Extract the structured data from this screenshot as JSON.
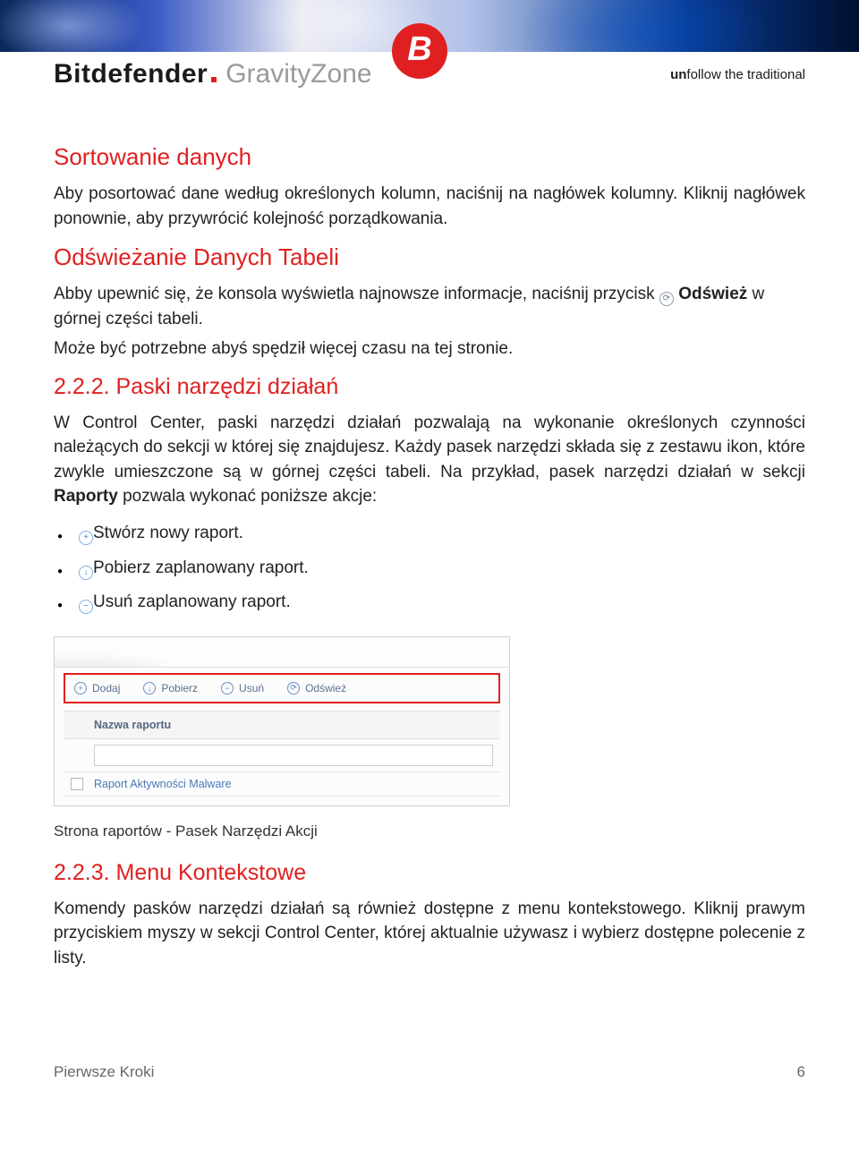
{
  "header": {
    "brand1": "Bitdefender",
    "brand2": "GravityZone",
    "badge_letter": "B",
    "tagline_prefix": "un",
    "tagline_rest": "follow the traditional"
  },
  "sort": {
    "heading": "Sortowanie danych",
    "para": "Aby posortować dane według określonych kolumn, naciśnij na nagłówek kolumny. Kliknij nagłówek ponownie, aby przywrócić kolejność porządkowania."
  },
  "refresh": {
    "heading": "Odświeżanie Danych Tabeli",
    "para1a": "Abby upewnić się, że konsola wyświetla najnowsze informacje, naciśnij przycisk ",
    "icon_glyph": "⟳",
    "para1b_bold": "Odśwież",
    "para1c": " w górnej części tabeli.",
    "para2": "Może być potrzebne abyś spędził więcej czasu na tej stronie."
  },
  "s222": {
    "heading": "2.2.2. Paski narzędzi działań",
    "para_a": "W Control Center, paski narzędzi działań pozwalają na wykonanie określonych czynności należących do sekcji w której się znajdujesz. Każdy pasek narzędzi składa się z zestawu ikon, które zwykle umieszczone są w górnej części tabeli. Na przykład, pasek narzędzi działań w sekcji ",
    "para_bold": "Raporty",
    "para_b": " pozwala wykonać poniższe akcje:",
    "bullets": {
      "b1_icon": "+",
      "b1_text": "Stwórz nowy raport.",
      "b2_icon": "↓",
      "b2_text": "Pobierz zaplanowany raport.",
      "b3_icon": "−",
      "b3_text": "Usuń zaplanowany raport."
    },
    "shot": {
      "tb1_icon": "+",
      "tb1": "Dodaj",
      "tb2_icon": "↓",
      "tb2": "Pobierz",
      "tb3_icon": "−",
      "tb3": "Usuń",
      "tb4_icon": "⟳",
      "tb4": "Odśwież",
      "col1": "Nazwa raportu",
      "row1": "Raport Aktywności Malware"
    },
    "caption": "Strona raportów - Pasek Narzędzi Akcji"
  },
  "s223": {
    "heading": "2.2.3. Menu Kontekstowe",
    "para": "Komendy pasków narzędzi działań są również dostępne z menu kontekstowego. Kliknij prawym przyciskiem myszy w sekcji Control Center, której aktualnie używasz i wybierz dostępne polecenie z listy."
  },
  "footer": {
    "left": "Pierwsze Kroki",
    "right": "6"
  }
}
